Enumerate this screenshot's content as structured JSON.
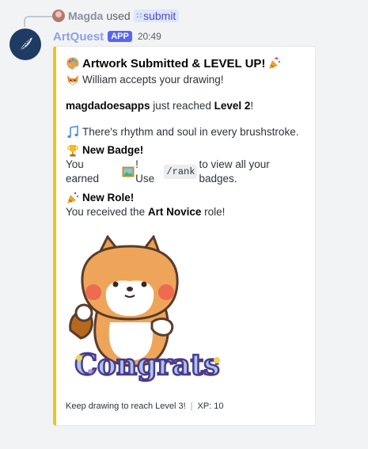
{
  "reply": {
    "user": "Magda",
    "used": "used",
    "command": "submit"
  },
  "message": {
    "bot_name": "ArtQuest",
    "badge": "APP",
    "time": "20:49"
  },
  "embed": {
    "accent_color": "#f0c419",
    "title": "Artwork Submitted & LEVEL UP!",
    "accept_line": "William accepts your drawing!",
    "level_user": "magdadoesapps",
    "level_mid": "just reached",
    "level_value": "Level 2",
    "level_end": "!",
    "rhythm_line": "There's rhythm and soul in every brushstroke.",
    "badge_heading": "New Badge!",
    "badge_pre": "You earned",
    "badge_mid": "! Use",
    "badge_cmd": "/rank",
    "badge_post": "to view all your badges.",
    "role_heading": "New Role!",
    "role_pre": "You received the",
    "role_name": "Art Novice",
    "role_post": "role!",
    "image_text": "Congrats",
    "footer_text": "Keep drawing to reach Level 3!",
    "footer_sep": "|",
    "footer_xp": "XP: 10"
  },
  "icons": {
    "palette": "palette-icon",
    "party": "party-popper-icon",
    "fox": "fox-icon",
    "notes": "music-notes-icon",
    "trophy": "trophy-icon",
    "badge": "framed-picture-icon",
    "avatar": "feather-icon"
  }
}
